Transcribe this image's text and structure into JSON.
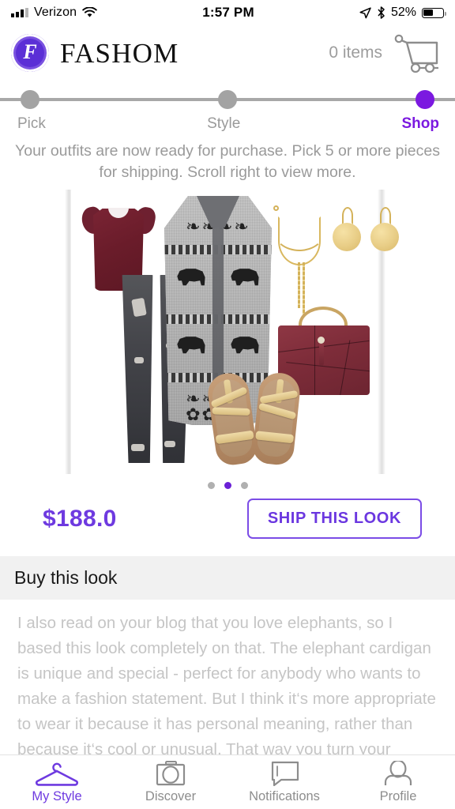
{
  "status_bar": {
    "carrier": "Verizon",
    "time": "1:57 PM",
    "battery_pct": "52%",
    "battery_level": 52,
    "icons": [
      "signal-bars-icon",
      "wifi-icon",
      "location-arrow-icon",
      "bluetooth-icon",
      "battery-icon"
    ]
  },
  "header": {
    "logo_letter": "F",
    "brand": "FASHOM",
    "cart_items": "0 items",
    "cart_icon": "shopping-cart-icon"
  },
  "stepper": {
    "steps": [
      {
        "label": "Pick",
        "state": "inactive"
      },
      {
        "label": "Style",
        "state": "inactive"
      },
      {
        "label": "Shop",
        "state": "active"
      }
    ],
    "active_color": "#7b19e0",
    "inactive_color": "#a3a3a3"
  },
  "instruction": "Your outfits are now ready for purchase. Pick 5 or more pieces for shipping. Scroll right to view more.",
  "look": {
    "items": [
      {
        "name": "burgundy-flutter-sleeve-blouse",
        "color": "#6d1f2c"
      },
      {
        "name": "grey-distressed-skinny-jeans",
        "color": "#44454a"
      },
      {
        "name": "grey-elephant-print-cardigan",
        "color": "#b9b9b9"
      },
      {
        "name": "gold-layered-y-necklace",
        "color": "#d4b25a"
      },
      {
        "name": "gold-disc-drop-earrings",
        "color": "#e8cd86"
      },
      {
        "name": "burgundy-ring-handle-handbag",
        "color": "#7d2c39"
      },
      {
        "name": "gold-strappy-flat-sandals",
        "color": "#d9bd7e"
      }
    ],
    "carousel": {
      "total": 3,
      "active_index": 1
    },
    "price": "$188.0",
    "ship_button": "SHIP THIS LOOK",
    "accent_color": "#6e3ae0"
  },
  "buy_section": {
    "heading": "Buy this look",
    "description": "I also read on your blog that you love elephants, so I based this look completely on that. The elephant cardigan is unique and special - perfect for anybody who wants to make a fashion statement. But I think it‘s more appropriate to wear it because it has personal meaning, rather than because it‘s cool or unusual. That way you turn your clothes into a conversation piece. The cardigan is probably a bit"
  },
  "tab_bar": {
    "tabs": [
      {
        "label": "My Style",
        "icon": "hanger-icon",
        "active": true
      },
      {
        "label": "Discover",
        "icon": "camera-icon",
        "active": false
      },
      {
        "label": "Notifications",
        "icon": "chat-bubble-icon",
        "active": false
      },
      {
        "label": "Profile",
        "icon": "person-icon",
        "active": false
      }
    ]
  }
}
